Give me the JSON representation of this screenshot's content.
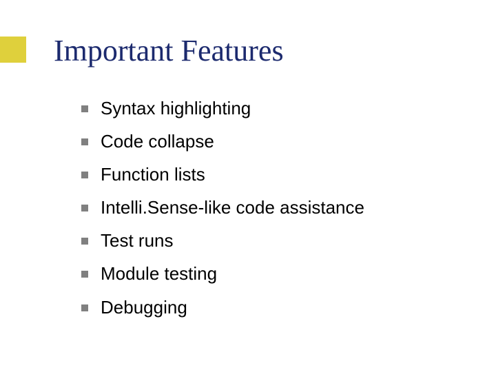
{
  "title": "Important Features",
  "bullets": [
    {
      "text": "Syntax  highlighting"
    },
    {
      "text": "Code collapse"
    },
    {
      "text": "Function lists"
    },
    {
      "text": "Intelli.Sense-like code assistance"
    },
    {
      "text": "Test runs"
    },
    {
      "text": "Module testing"
    },
    {
      "text": "Debugging"
    }
  ]
}
